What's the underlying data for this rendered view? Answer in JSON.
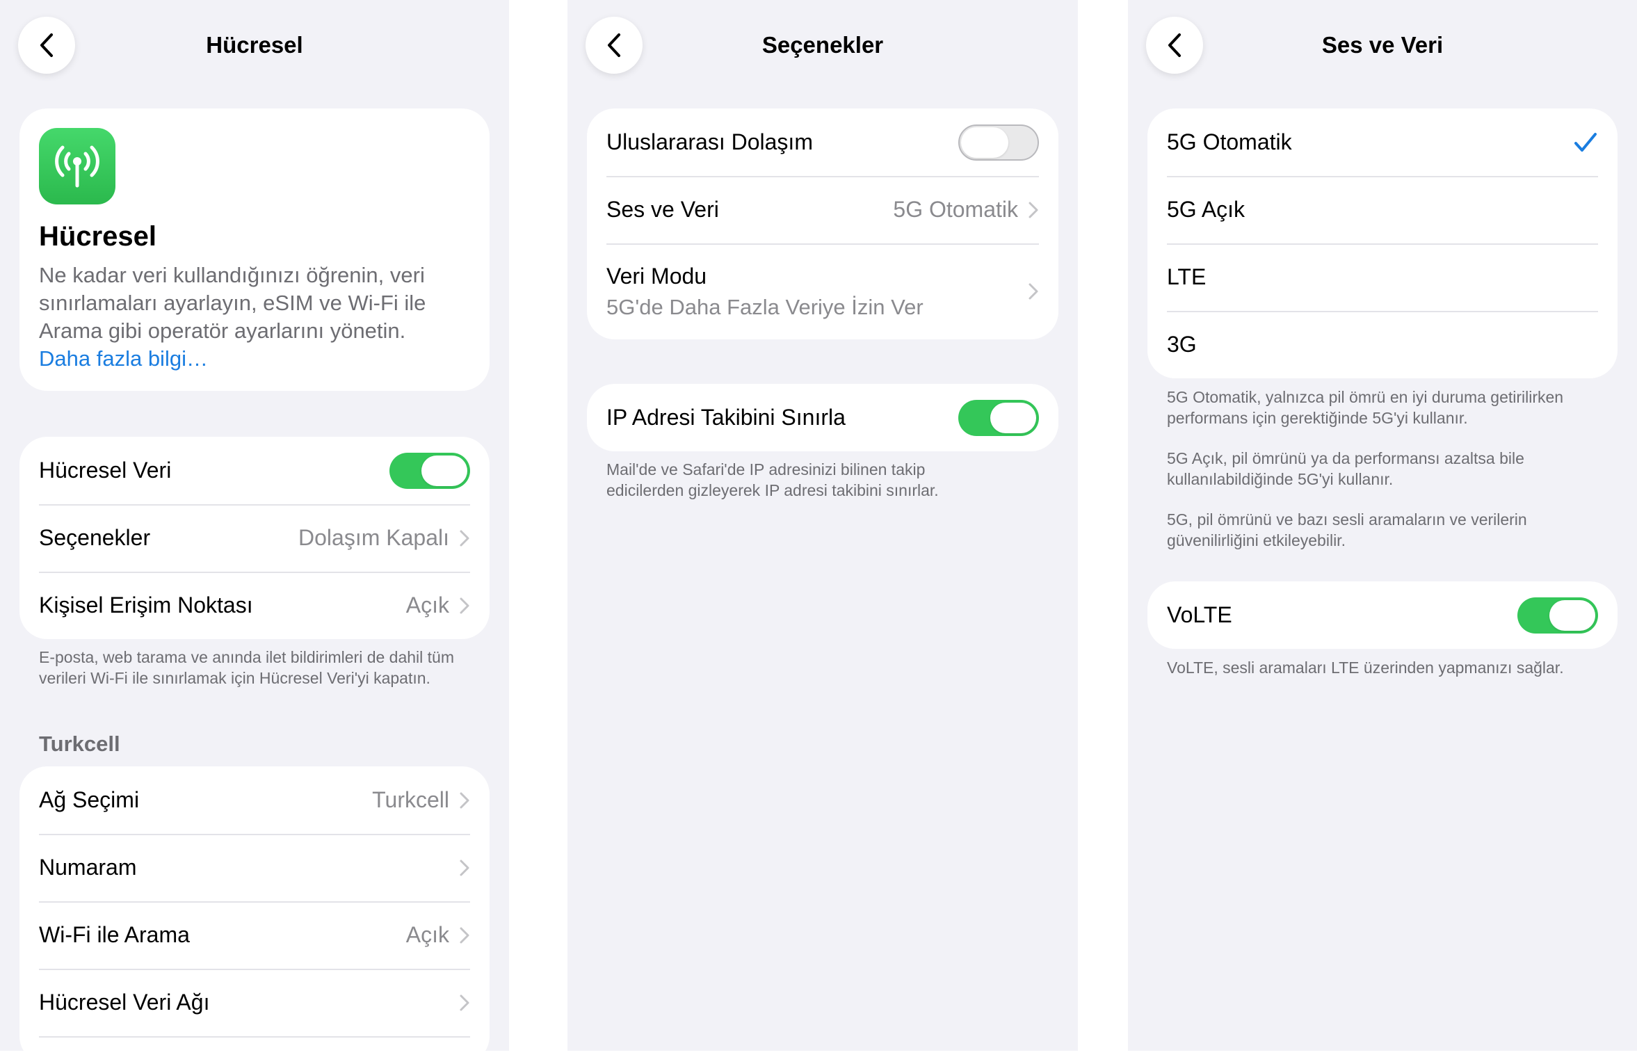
{
  "panel_cellular": {
    "title": "Hücresel",
    "hero": {
      "heading": "Hücresel",
      "description": "Ne kadar veri kullandığınızı öğrenin, veri sınırlamaları ayarlayın, eSIM ve Wi-Fi ile Arama gibi operatör ayarlarını yönetin.",
      "link": "Daha fazla bilgi…"
    },
    "data_rows": [
      {
        "label": "Hücresel Veri",
        "toggle": "on"
      },
      {
        "label": "Seçenekler",
        "value": "Dolaşım Kapalı"
      },
      {
        "label": "Kişisel Erişim Noktası",
        "value": "Açık"
      }
    ],
    "data_footnote": "E-posta, web tarama ve anında ilet bildirimleri de dahil tüm verileri Wi-Fi ile sınırlamak için Hücresel Veri'yi kapatın.",
    "carrier_header": "Turkcell",
    "carrier_rows": [
      {
        "label": "Ağ Seçimi",
        "value": "Turkcell"
      },
      {
        "label": "Numaram",
        "value": ""
      },
      {
        "label": "Wi-Fi ile Arama",
        "value": "Açık"
      },
      {
        "label": "Hücresel Veri Ağı",
        "value": ""
      }
    ]
  },
  "panel_options": {
    "title": "Seçenekler",
    "rows": [
      {
        "label": "Uluslararası Dolaşım",
        "toggle": "off"
      },
      {
        "label": "Ses ve Veri",
        "value": "5G Otomatik"
      },
      {
        "label": "Veri Modu",
        "sub": "5G'de Daha Fazla Veriye İzin Ver"
      }
    ],
    "ip_row": {
      "label": "IP Adresi Takibini Sınırla",
      "toggle": "on"
    },
    "ip_footnote": "Mail'de ve Safari'de IP adresinizi bilinen takip edicilerden gizleyerek IP adresi takibini sınırlar."
  },
  "panel_voice": {
    "title": "Ses ve Veri",
    "options": [
      {
        "label": "5G Otomatik",
        "selected": true
      },
      {
        "label": "5G Açık",
        "selected": false
      },
      {
        "label": "LTE",
        "selected": false
      },
      {
        "label": "3G",
        "selected": false
      }
    ],
    "notes": [
      "5G Otomatik, yalnızca pil ömrü en iyi duruma getirilirken performans için gerektiğinde 5G'yi kullanır.",
      "5G Açık, pil ömrünü ya da performansı azaltsa bile kullanılabildiğinde 5G'yi kullanır.",
      "5G, pil ömrünü ve bazı sesli aramaların ve verilerin güvenilirliğini etkileyebilir."
    ],
    "volte": {
      "label": "VoLTE",
      "toggle": "on"
    },
    "volte_footnote": "VoLTE, sesli aramaları LTE üzerinden yapmanızı sağlar."
  },
  "colors": {
    "background": "#f2f2f7",
    "card": "#ffffff",
    "toggle_on": "#34c759",
    "link": "#1a7de0",
    "checkmark": "#1a7de0",
    "secondary_text": "#8a8a8e"
  },
  "icons": [
    "back-chevron-icon",
    "cellular-antenna-icon",
    "chevron-right-icon",
    "checkmark-icon"
  ]
}
